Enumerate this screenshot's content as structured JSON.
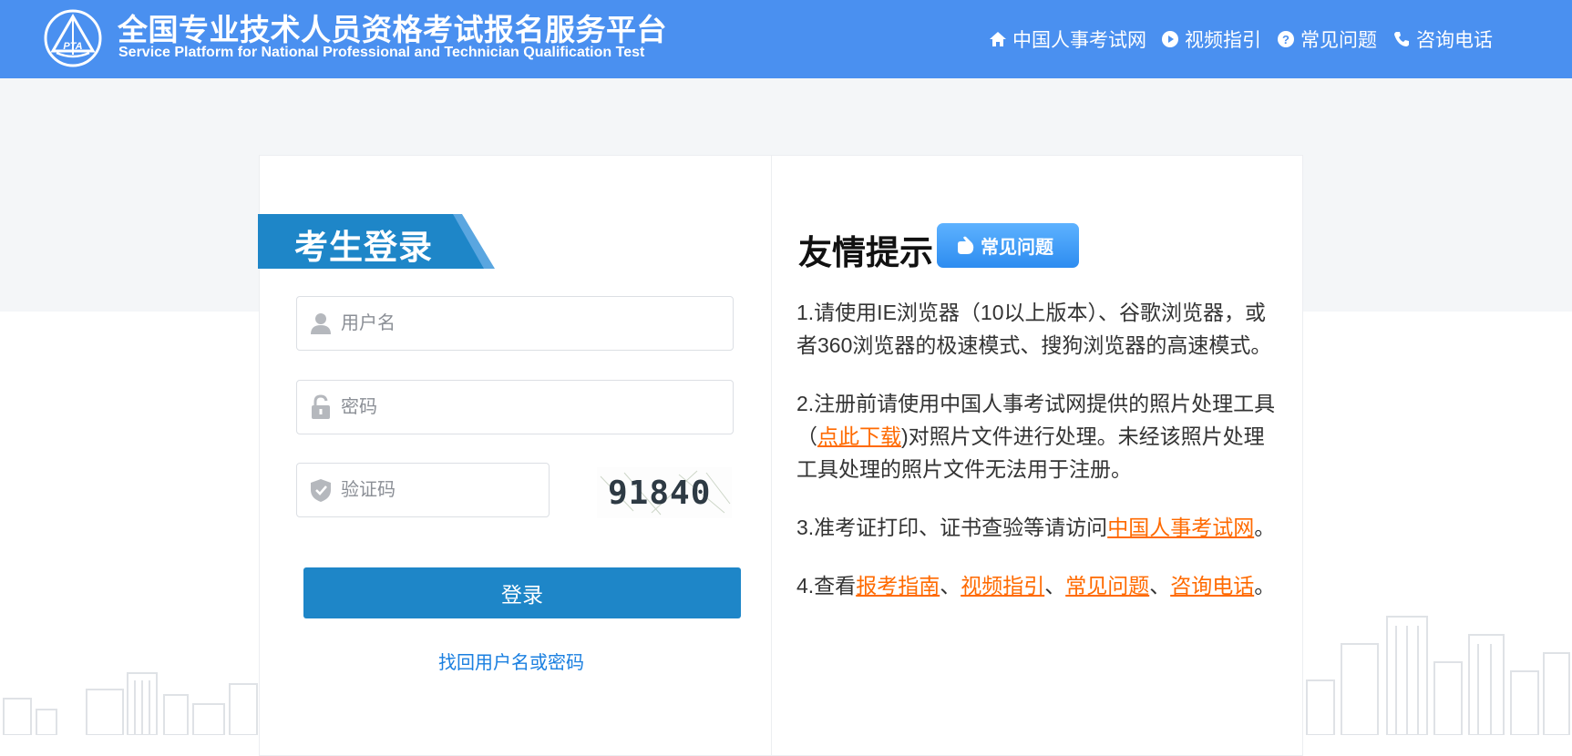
{
  "header": {
    "title_zh": "全国专业技术人员资格考试报名服务平台",
    "title_en": "Service Platform for National Professional and Technician Qualification Test",
    "logo_text": "PTA",
    "nav": {
      "cpta": "中国人事考试网",
      "video": "视频指引",
      "faq": "常见问题",
      "phone": "咨询电话"
    }
  },
  "login": {
    "title": "考生登录",
    "username_placeholder": "用户名",
    "password_placeholder": "密码",
    "captcha_placeholder": "验证码",
    "captcha_text": "91840",
    "submit_label": "登录",
    "forgot_label": "找回用户名或密码"
  },
  "tips": {
    "title": "友情提示",
    "faq_button": "常见问题",
    "item1": "1.请使用IE浏览器（10以上版本）、谷歌浏览器，或者360浏览器的极速模式、搜狗浏览器的高速模式。",
    "item2_pre": "2.注册前请使用中国人事考试网提供的照片处理工具（",
    "item2_link": "点此下载",
    "item2_post": ")对照片文件进行处理。未经该照片处理工具处理的照片文件无法用于注册。",
    "item3_pre": "3.准考证打印、证书查验等请访问",
    "item3_link": "中国人事考试网",
    "item3_post": "。",
    "item4_pre": "4.查看",
    "item4_link1": "报考指南",
    "sep1": "、",
    "item4_link2": "视频指引",
    "sep2": "、",
    "item4_link3": "常见问题",
    "sep3": "、",
    "item4_link4": "咨询电话",
    "item4_post": "。"
  },
  "colors": {
    "header_bg": "#4a90f0",
    "login_ribbon": "#1e86c8",
    "link_orange": "#ff6a00",
    "link_blue": "#1a7fe0"
  }
}
